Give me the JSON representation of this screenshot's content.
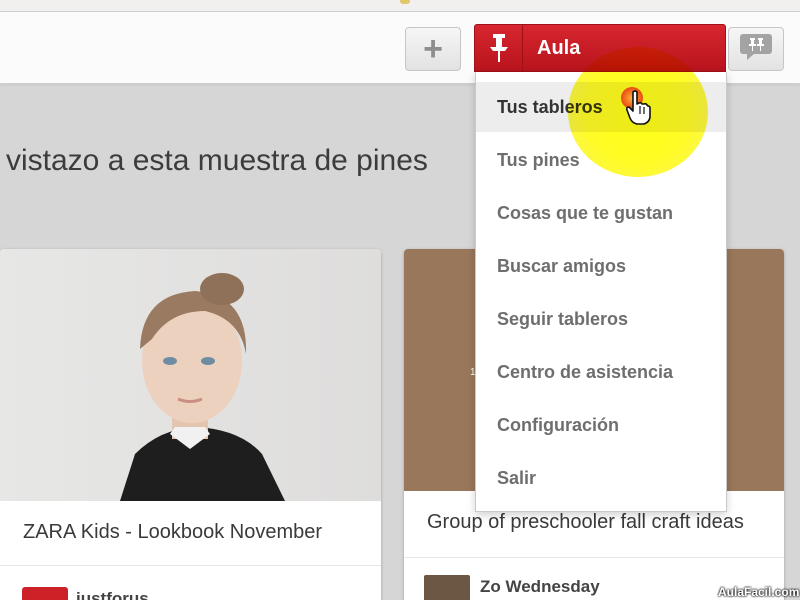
{
  "header": {
    "add_icon": "plus-icon",
    "user_name": "Aula",
    "pin_icon": "pushpin-icon",
    "notification_icon": "notifications-pins-icon",
    "accent_color": "#cc2127"
  },
  "headline": "vistazo a esta muestra de pines",
  "menu": {
    "items": [
      {
        "label": "Tus tableros",
        "active": true
      },
      {
        "label": "Tus pines",
        "active": false
      },
      {
        "label": "Cosas que te gustan",
        "active": false
      },
      {
        "label": "Buscar amigos",
        "active": false
      },
      {
        "label": "Seguir tableros",
        "active": false
      },
      {
        "label": "Centro de asistencia",
        "active": false
      },
      {
        "label": "Configuración",
        "active": false
      },
      {
        "label": "Salir",
        "active": false
      }
    ]
  },
  "pins": [
    {
      "title": "ZARA Kids - Lookbook November",
      "user": "justforus"
    },
    {
      "title": "Group of preschooler fall craft ideas",
      "user": "Zo Wednesday",
      "fragment": "1"
    }
  ],
  "watermark": "AulaFacil.com"
}
